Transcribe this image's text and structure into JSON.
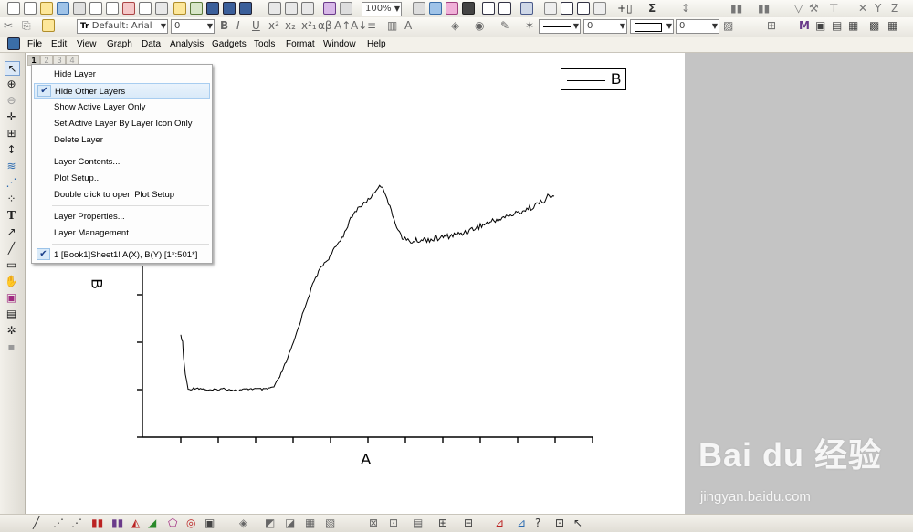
{
  "toolbar2": {
    "font_name": "Default: Arial",
    "font_size": "0",
    "zoom": "100%",
    "line_width_a": "0",
    "line_width_b": "0"
  },
  "menubar": {
    "items": [
      "File",
      "Edit",
      "View",
      "Graph",
      "Data",
      "Analysis",
      "Gadgets",
      "Tools",
      "Format",
      "Window",
      "Help"
    ]
  },
  "layer_tabs": [
    "1",
    "2",
    "3",
    "4"
  ],
  "context_menu": {
    "items": [
      {
        "label": "Hide Layer",
        "checked": false,
        "highlighted": false
      },
      {
        "label": "Hide Other Layers",
        "checked": true,
        "highlighted": true
      },
      {
        "label": "Show Active Layer Only",
        "checked": false,
        "highlighted": false
      },
      {
        "label": "Set Active Layer By Layer Icon Only",
        "checked": false,
        "highlighted": false
      },
      {
        "label": "Delete Layer",
        "checked": false,
        "highlighted": false
      },
      {
        "label": "Layer Contents...",
        "checked": false,
        "highlighted": false
      },
      {
        "label": "Plot Setup...",
        "checked": false,
        "highlighted": false
      },
      {
        "label": "Double click to open Plot Setup",
        "checked": false,
        "highlighted": false
      },
      {
        "label": "Layer Properties...",
        "checked": false,
        "highlighted": false
      },
      {
        "label": "Layer Management...",
        "checked": false,
        "highlighted": false
      },
      {
        "label": "1    [Book1]Sheet1! A(X), B(Y) [1*:501*]",
        "checked": true,
        "highlighted": false
      }
    ]
  },
  "graph": {
    "x_axis_label": "A",
    "y_axis_label": "B",
    "legend_label": "B"
  },
  "watermark": {
    "brand": "Bai du 经验",
    "url": "jingyan.baidu.com"
  },
  "icons": {
    "check": "✔",
    "pointer": "pointer-icon",
    "zoom": "zoom-icon",
    "text": "T"
  }
}
